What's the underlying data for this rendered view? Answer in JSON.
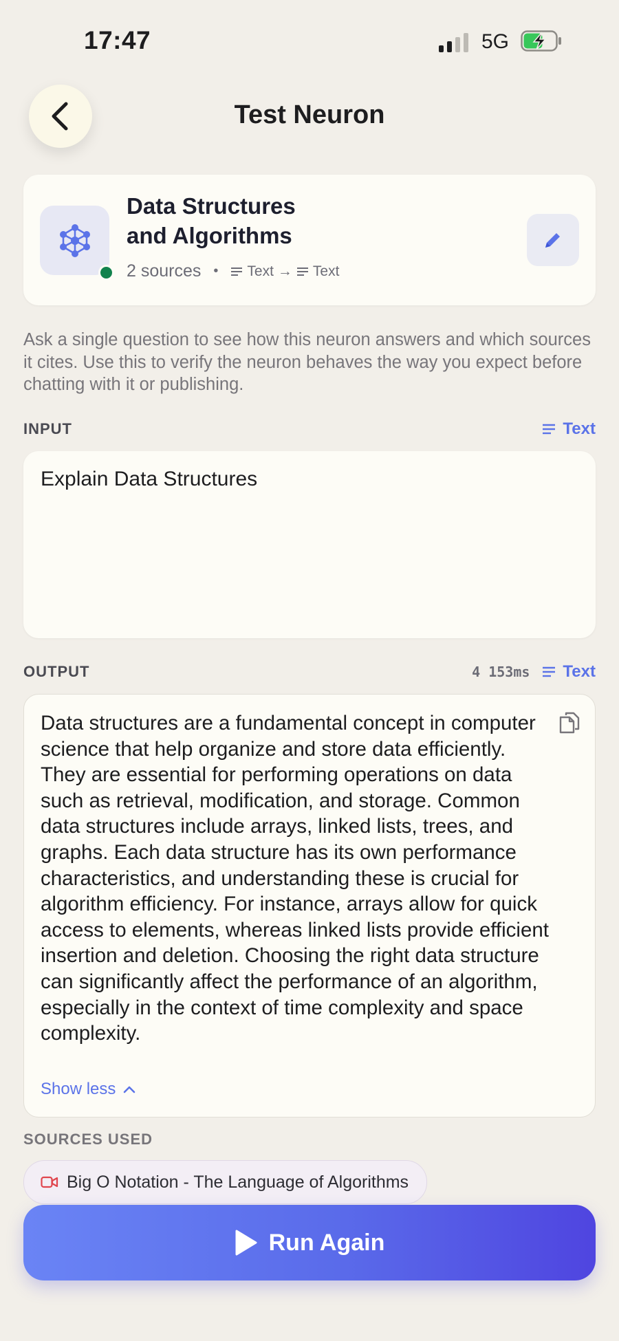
{
  "status_bar": {
    "time": "17:47",
    "network": "5G"
  },
  "header": {
    "title": "Test Neuron"
  },
  "neuron": {
    "name_line1": "Data Structures",
    "name_line2": "and Algorithms",
    "sources_count": "2 sources",
    "separator": "•",
    "input_type": "Text",
    "arrow": "→",
    "output_type": "Text"
  },
  "description": "Ask a single question to see how this neuron answers and which sources it cites. Use this to verify the neuron behaves the way you expect before chatting with it or publishing.",
  "input_section": {
    "label": "INPUT",
    "type_label": "Text",
    "value": "Explain Data Structures"
  },
  "output_section": {
    "label": "OUTPUT",
    "latency": "4 153ms",
    "type_label": "Text",
    "text": "Data structures are a fundamental concept in computer science that help organize and store data efficiently. They are essential for performing operations on data such as retrieval, modification, and storage. Common data structures include arrays, linked lists, trees, and graphs. Each data structure has its own performance characteristics, and understanding these is crucial for algorithm efficiency. For instance, arrays allow for quick access to elements, whereas linked lists provide efficient insertion and deletion. Choosing the right data structure can significantly affect the performance of an algorithm, especially in the context of time complexity and space complexity.",
    "show_less_label": "Show less"
  },
  "sources_section": {
    "label": "SOURCES USED",
    "items": [
      {
        "title": "Big O Notation - The Language of Algorithms",
        "icon": "video-icon"
      }
    ]
  },
  "run_button": {
    "label": "Run Again"
  },
  "colors": {
    "accent": "#5b73e8",
    "background": "#f2efe9",
    "online": "#11824d"
  }
}
